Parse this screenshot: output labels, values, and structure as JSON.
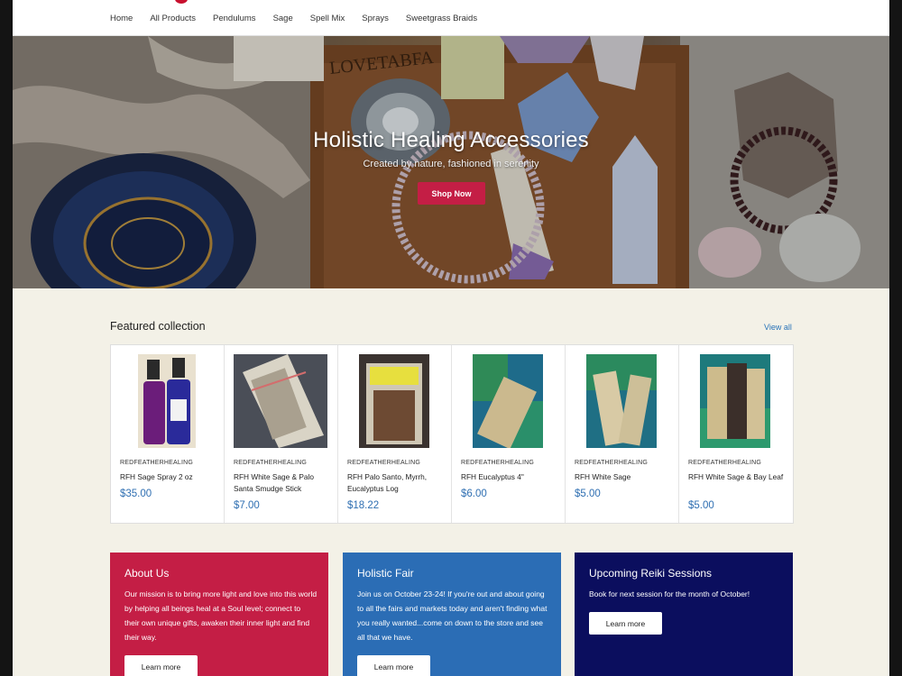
{
  "nav": {
    "items": [
      "Home",
      "All Products",
      "Pendulums",
      "Sage",
      "Spell Mix",
      "Sprays",
      "Sweetgrass Braids"
    ]
  },
  "hero": {
    "title": "Holistic Healing Accessories",
    "subtitle": "Created by nature, fashioned in serenity",
    "button": "Shop Now",
    "carved_text": "LOVETABFA"
  },
  "featured": {
    "title": "Featured collection",
    "view_all": "View all",
    "products": [
      {
        "vendor": "REDFEATHERHEALING",
        "name": "RFH Sage Spray 2 oz",
        "price": "$35.00"
      },
      {
        "vendor": "REDFEATHERHEALING",
        "name": "RFH White Sage & Palo Santa Smudge Stick",
        "price": "$7.00"
      },
      {
        "vendor": "REDFEATHERHEALING",
        "name": "RFH Palo Santo, Myrrh, Eucalyptus Log",
        "price": "$18.22"
      },
      {
        "vendor": "REDFEATHERHEALING",
        "name": "RFH Eucalyptus 4\"",
        "price": "$6.00"
      },
      {
        "vendor": "REDFEATHERHEALING",
        "name": "RFH White Sage",
        "price": "$5.00"
      },
      {
        "vendor": "REDFEATHERHEALING",
        "name": "RFH White Sage & Bay Leaf",
        "price": "$5.00"
      }
    ]
  },
  "blocks": [
    {
      "title": "About Us",
      "text": "Our mission is to bring more light and love into this world by helping all beings heal at a Soul level; connect to their own unique gifts, awaken their inner light and find their way.",
      "button": "Learn more",
      "color": "#c41e45"
    },
    {
      "title": "Holistic Fair",
      "text": "Join us on October 23-24! If you're out and about going to all the fairs and markets today and aren't finding what you really wanted...come on down to the store and see all that we have.",
      "button": "Learn more",
      "color": "#2b6db5"
    },
    {
      "title": "Upcoming Reiki Sessions",
      "text": "Book for next session for the month of October!",
      "button": "Learn more",
      "color": "#0b0e5e"
    }
  ],
  "colors": {
    "accent": "#c41e45",
    "link": "#2873b8",
    "price": "#2f6fb2",
    "background": "#f3f1e7"
  }
}
